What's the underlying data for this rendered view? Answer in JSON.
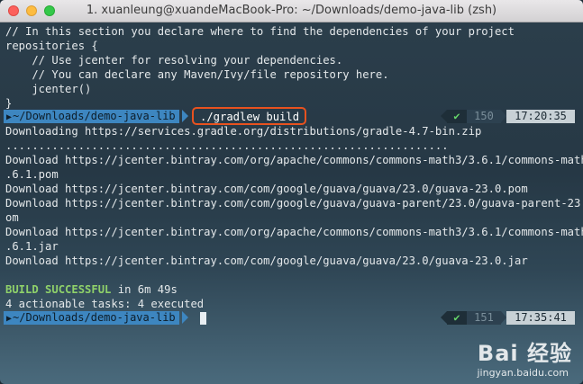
{
  "window": {
    "title": "1. xuanleung@xuandeMacBook-Pro: ~/Downloads/demo-java-lib (zsh)"
  },
  "terminal": {
    "output_top": [
      "// In this section you declare where to find the dependencies of your project",
      "repositories {",
      "    // Use jcenter for resolving your dependencies.",
      "    // You can declare any Maven/Ivy/file repository here.",
      "    jcenter()",
      "}"
    ],
    "prompt1": {
      "path": "~/Downloads/demo-java-lib",
      "command": "./gradlew build",
      "status_icon": "check-icon",
      "status_glyph": "✔",
      "history": "150",
      "time": "17:20:35"
    },
    "output_build": [
      "Downloading https://services.gradle.org/distributions/gradle-4.7-bin.zip",
      "...................................................................",
      "Download https://jcenter.bintray.com/org/apache/commons/commons-math3/3.6.1/commons-math3-3",
      ".6.1.pom",
      "Download https://jcenter.bintray.com/com/google/guava/guava/23.0/guava-23.0.pom",
      "Download https://jcenter.bintray.com/com/google/guava/guava-parent/23.0/guava-parent-23.0.p",
      "om",
      "Download https://jcenter.bintray.com/org/apache/commons/commons-math3/3.6.1/commons-math3-3",
      ".6.1.jar",
      "Download https://jcenter.bintray.com/com/google/guava/guava/23.0/guava-23.0.jar"
    ],
    "result": {
      "success_label": "BUILD SUCCESSFUL",
      "duration": " in 6m 49s",
      "tasks": "4 actionable tasks: 4 executed"
    },
    "prompt2": {
      "path": "~/Downloads/demo-java-lib",
      "status_glyph": "✔",
      "history": "151",
      "time": "17:35:41"
    },
    "colors": {
      "path_bg": "#3d86c0",
      "highlight_box": "#e8521f",
      "success": "#8fd16a"
    }
  },
  "watermark": {
    "logo": "Bai 经验",
    "url": "jingyan.baidu.com"
  }
}
